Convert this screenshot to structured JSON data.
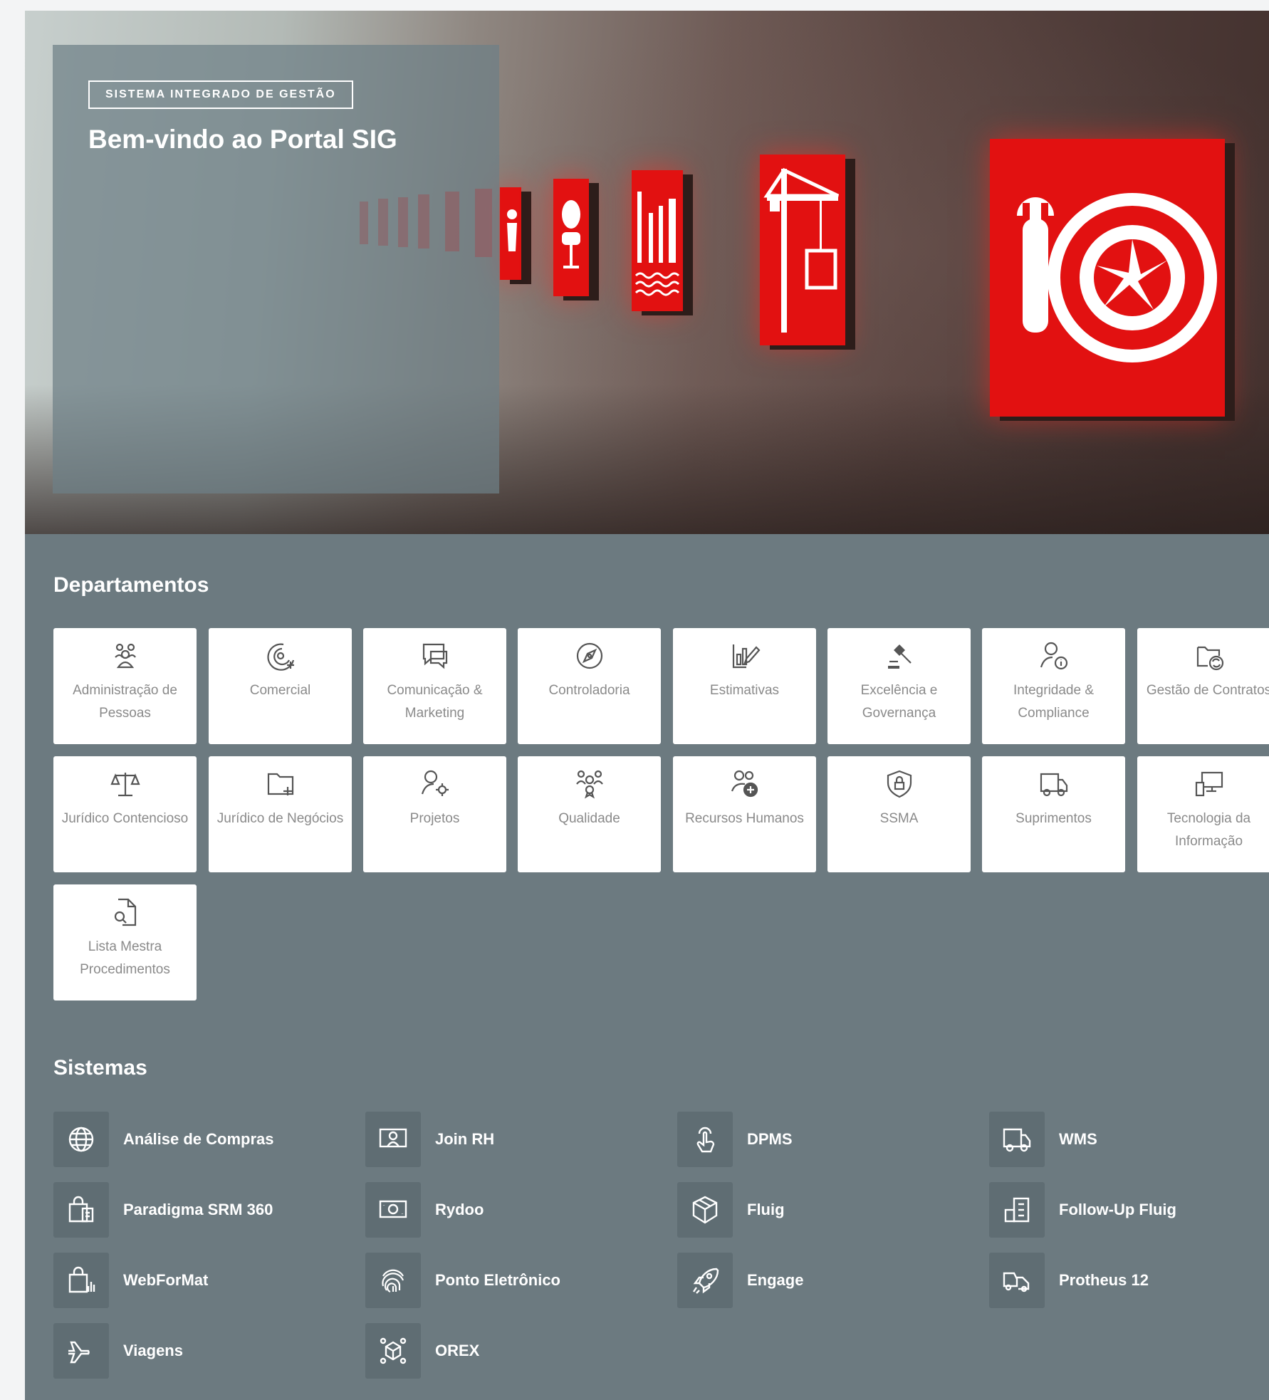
{
  "hero": {
    "badge": "SISTEMA INTEGRADO DE GESTÃO",
    "title": "Bem-vindo ao Portal SIG"
  },
  "departments": {
    "title": "Departamentos",
    "items": [
      {
        "label": "Administração de Pessoas",
        "icon": "people-group-icon"
      },
      {
        "label": "Comercial",
        "icon": "target-add-icon"
      },
      {
        "label": "Comunicação & Marketing",
        "icon": "chat-bubbles-icon"
      },
      {
        "label": "Controladoria",
        "icon": "compass-icon"
      },
      {
        "label": "Estimativas",
        "icon": "chart-pencil-icon"
      },
      {
        "label": "Excelência e Governança",
        "icon": "gavel-icon"
      },
      {
        "label": "Integridade & Compliance",
        "icon": "person-info-icon"
      },
      {
        "label": "Gestão de Contratos",
        "icon": "folder-sync-icon"
      },
      {
        "label": "Jurídico Contencioso",
        "icon": "scales-icon"
      },
      {
        "label": "Jurídico de Negócios",
        "icon": "folder-add-icon"
      },
      {
        "label": "Projetos",
        "icon": "person-settings-icon"
      },
      {
        "label": "Qualidade",
        "icon": "people-award-icon"
      },
      {
        "label": "Recursos Humanos",
        "icon": "people-add-icon"
      },
      {
        "label": "SSMA",
        "icon": "shield-lock-icon"
      },
      {
        "label": "Suprimentos",
        "icon": "truck-icon"
      },
      {
        "label": "Tecnologia da Informação",
        "icon": "devices-icon"
      },
      {
        "label": "Lista Mestra Procedimentos",
        "icon": "document-search-icon"
      }
    ]
  },
  "systems": {
    "title": "Sistemas",
    "items": [
      {
        "label": "Análise de Compras",
        "icon": "globe-icon"
      },
      {
        "label": "Join RH",
        "icon": "person-board-icon"
      },
      {
        "label": "DPMS",
        "icon": "touch-icon"
      },
      {
        "label": "WMS",
        "icon": "truck-icon"
      },
      {
        "label": "Paradigma SRM 360",
        "icon": "shopping-bag-icon"
      },
      {
        "label": "Rydoo",
        "icon": "money-icon"
      },
      {
        "label": "Fluig",
        "icon": "box-icon"
      },
      {
        "label": "Follow-Up Fluig",
        "icon": "building-icon"
      },
      {
        "label": "WebForMat",
        "icon": "bag-chart-icon"
      },
      {
        "label": "Ponto Eletrônico",
        "icon": "fingerprint-icon"
      },
      {
        "label": "Engage",
        "icon": "rocket-icon"
      },
      {
        "label": "Protheus 12",
        "icon": "vehicles-icon"
      },
      {
        "label": "Viagens",
        "icon": "airplane-icon"
      },
      {
        "label": "OREX",
        "icon": "cube-network-icon"
      }
    ]
  },
  "colors": {
    "page_bg": "#6c7a80",
    "tile_bg": "#ffffff",
    "tile_text": "#8a8a8a",
    "system_icon_bg": "#5f6d73",
    "sign_red": "#e21111"
  }
}
